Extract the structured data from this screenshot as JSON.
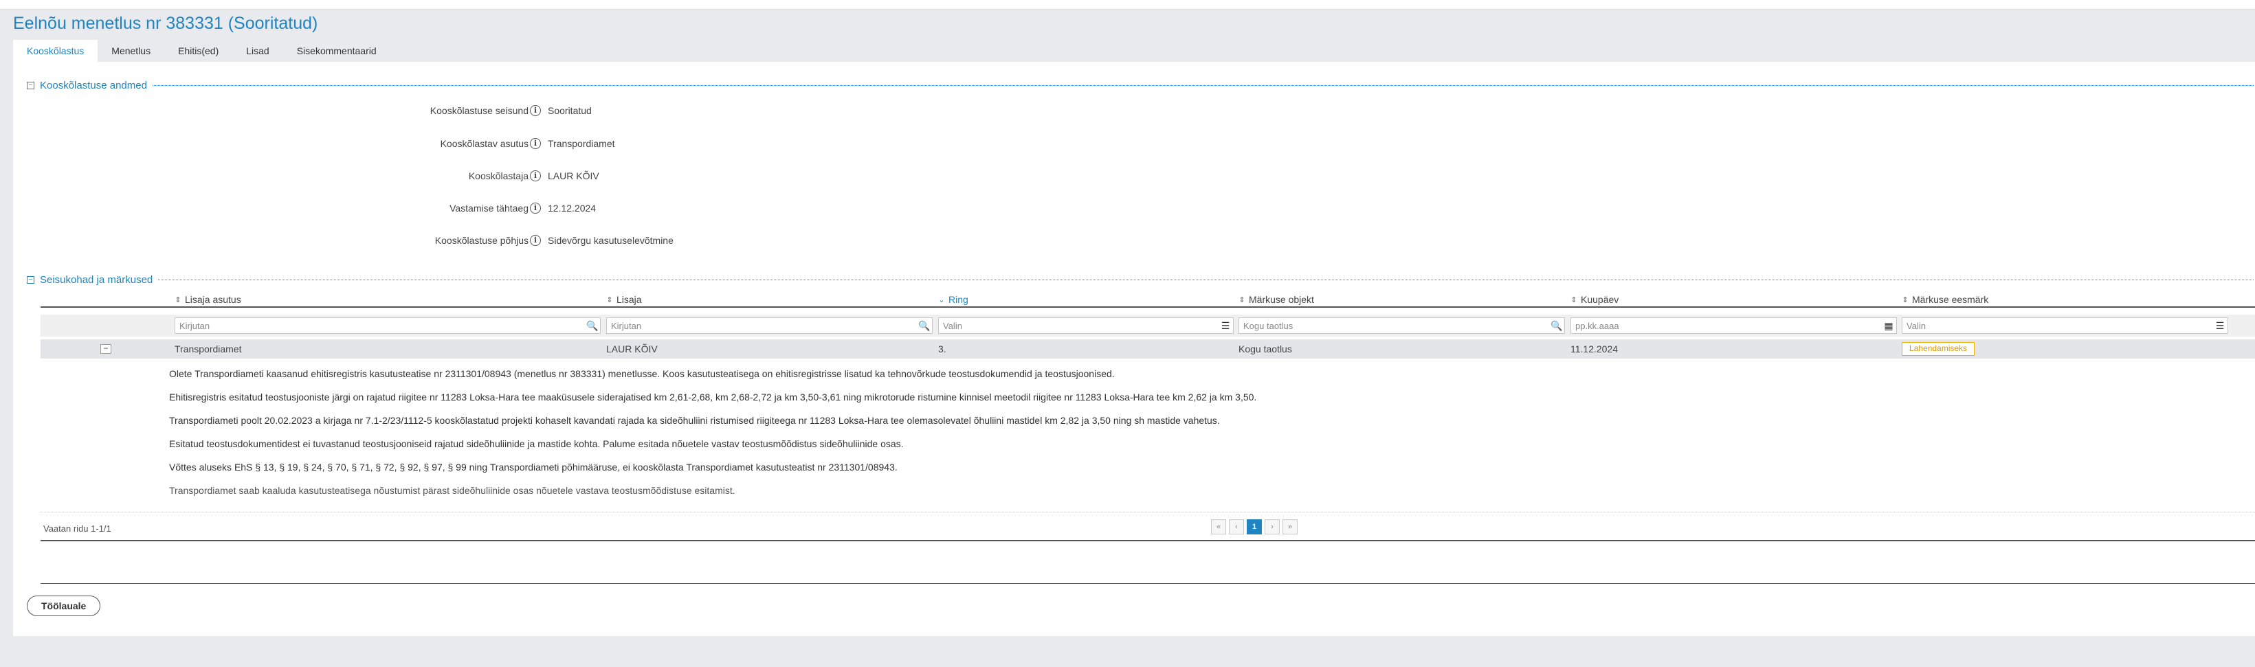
{
  "page": {
    "title": "Eelnõu menetlus nr 383331 (Sooritatud)"
  },
  "tabs": [
    {
      "label": "Kooskõlastus"
    },
    {
      "label": "Menetlus"
    },
    {
      "label": "Ehitis(ed)"
    },
    {
      "label": "Lisad"
    },
    {
      "label": "Sisekommentaarid"
    }
  ],
  "approval_section": {
    "title": "Kooskõlastuse andmed",
    "fields": [
      {
        "label": "Kooskõlastuse seisund",
        "value": "Sooritatud"
      },
      {
        "label": "Kooskõlastav asutus",
        "value": "Transpordiamet"
      },
      {
        "label": "Kooskõlastaja",
        "value": "LAUR KÕIV"
      },
      {
        "label": "Vastamise tähtaeg",
        "value": "12.12.2024"
      },
      {
        "label": "Kooskõlastuse põhjus",
        "value": "Sidevõrgu kasutuselevõtmine"
      }
    ]
  },
  "remarks_section": {
    "title": "Seisukohad ja märkused",
    "columns": [
      "Lisaja asutus",
      "Lisaja",
      "Ring",
      "Märkuse objekt",
      "Kuupäev",
      "Märkuse eesmärk"
    ],
    "filters": [
      {
        "placeholder": "Kirjutan",
        "icon": "search-icon"
      },
      {
        "placeholder": "Kirjutan",
        "icon": "search-icon"
      },
      {
        "placeholder": "Valin",
        "icon": "list-icon"
      },
      {
        "placeholder": "Kogu taotlus",
        "icon": "search-icon"
      },
      {
        "placeholder": "pp.kk.aaaa",
        "icon": "calendar-icon"
      },
      {
        "placeholder": "Valin",
        "icon": "list-icon"
      }
    ],
    "row": {
      "toggle": "−",
      "cells": [
        "Transpordiamet",
        "LAUR KÕIV",
        "3.",
        "Kogu taotlus",
        "11.12.2024"
      ],
      "badge": "Lahendamiseks"
    },
    "details": [
      "Olete Transpordiameti kaasanud ehitisregistris kasutusteatise nr 2311301/08943 (menetlus nr 383331) menetlusse. Koos kasutusteatisega on ehitisregistrisse lisatud ka tehnovõrkude teostusdokumendid ja teostusjoonised.",
      "Ehitisregistris esitatud teostusjooniste järgi on rajatud riigitee nr 11283 Loksa-Hara tee maaküsusele siderajatised km 2,61-2,68, km 2,68-2,72 ja km 3,50-3,61 ning mikrotorude ristumine kinnisel meetodil riigitee nr 11283 Loksa-Hara tee km 2,62 ja km 3,50.",
      "Transpordiameti poolt 20.02.2023 a kirjaga nr 7.1-2/23/1112-5 kooskõlastatud projekti kohaselt kavandati rajada ka sideõhuliini ristumised riigiteega nr 11283 Loksa-Hara tee olemasolevatel õhuliini mastidel km 2,82 ja 3,50 ning sh mastide vahetus.",
      "Esitatud teostusdokumentidest ei tuvastanud teostusjooniseid rajatud sideõhuliinide ja mastide kohta. Palume esitada nõuetele vastav teostusmõõdistus sideõhuliinide osas.",
      "Võttes aluseks EhS § 13, § 19, § 24, § 70, § 71, § 72, § 92, § 97, § 99 ning Transpordiameti põhimääruse, ei kooskõlasta Transpordiamet kasutusteatist nr 2311301/08943.",
      "Transpordiamet saab kaaluda kasutusteatisega nõustumist pärast sideõhuliinide osas nõuetele vastava teostusmõõdistuse esitamist."
    ],
    "pager": {
      "status": "Vaatan ridu 1-1/1",
      "first": "«",
      "prev": "‹",
      "current": "1",
      "next": "›",
      "last": "»"
    }
  },
  "footer": {
    "work_button": "Töölauale"
  }
}
